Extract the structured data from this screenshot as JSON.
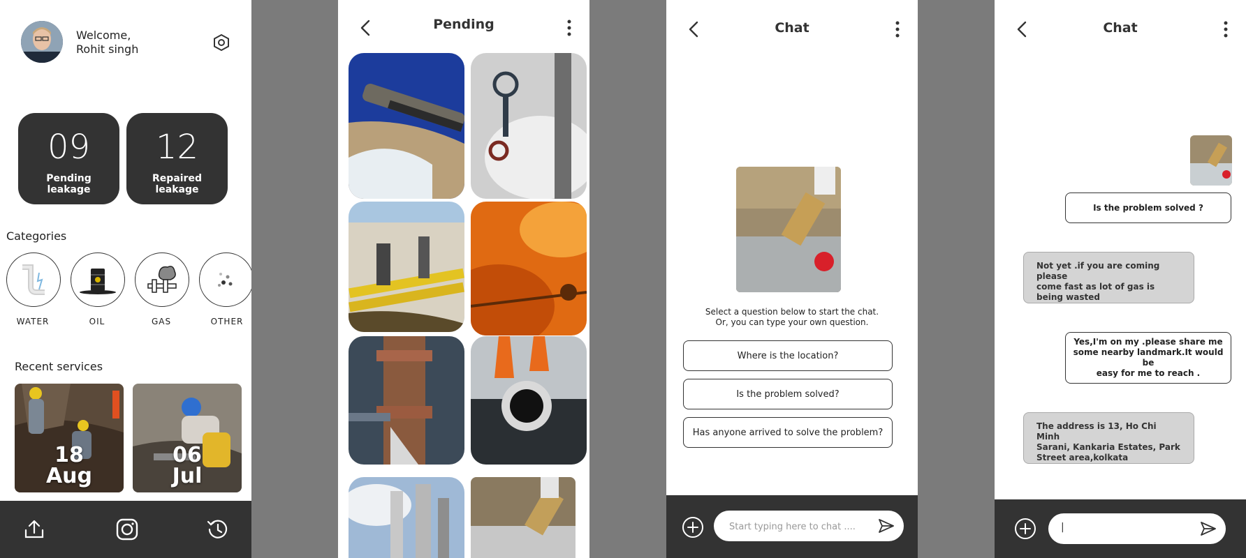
{
  "home": {
    "welcome": "Welcome,",
    "user_name": "Rohit singh",
    "stats": [
      {
        "number": "09",
        "label_line1": "Pending",
        "label_line2": "leakage"
      },
      {
        "number": "12",
        "label_line1": "Repaired",
        "label_line2": "leakage"
      }
    ],
    "categories_title": "Categories",
    "categories": [
      {
        "label": "WATER",
        "icon": "water-pipe-icon"
      },
      {
        "label": "OIL",
        "icon": "oil-barrel-icon"
      },
      {
        "label": "GAS",
        "icon": "gas-leak-icon"
      },
      {
        "label": "OTHER",
        "icon": "other-dots-icon"
      }
    ],
    "recent_title": "Recent services",
    "recent": [
      {
        "day": "18",
        "month": "Aug"
      },
      {
        "day": "06",
        "month": "Jul"
      }
    ],
    "bottom_nav": [
      "upload-icon",
      "camera-icon",
      "history-icon"
    ]
  },
  "pending": {
    "title": "Pending"
  },
  "chat_start": {
    "title": "Chat",
    "hint_line1": "Select a question below to start the chat.",
    "hint_line2": "Or, you can type your own question.",
    "questions": [
      "Where is the location?",
      "Is the problem solved?",
      "Has anyone arrived to solve the problem?"
    ],
    "input_placeholder": "Start typing here to chat ...."
  },
  "chat_thread": {
    "title": "Chat",
    "messages": [
      {
        "from": "me",
        "text": "Is the problem solved ?"
      },
      {
        "from": "them",
        "line1": "Not yet .if you are coming please",
        "line2": "come fast as lot of gas is",
        "line3": "being wasted"
      },
      {
        "from": "me",
        "line1": "Yes,I'm on my .please share me",
        "line2": "some nearby landmark.It would be",
        "line3": "easy for me to reach ."
      },
      {
        "from": "them",
        "line1": "The address is 13, Ho Chi Minh",
        "line2": "Sarani, Kankaria Estates, Park",
        "line3": "Street area,kolkata"
      }
    ],
    "input_value": "|"
  },
  "colors": {
    "dark": "#333333",
    "bubble_in": "#d4d4d4",
    "background": "#7b7b7b"
  }
}
